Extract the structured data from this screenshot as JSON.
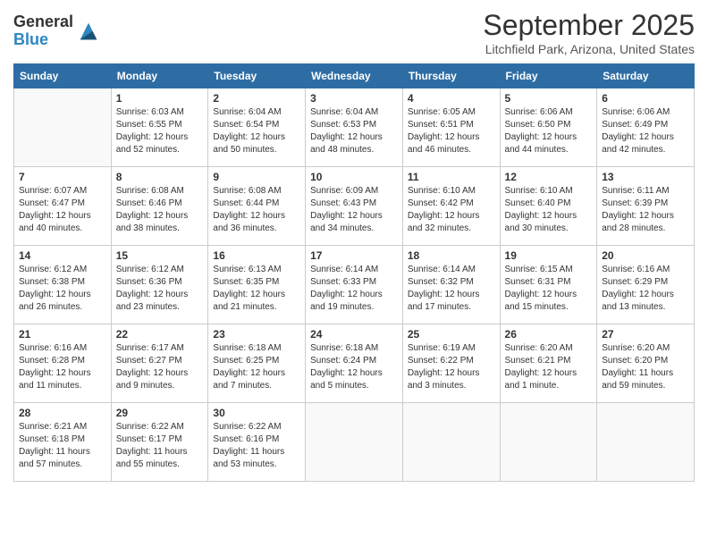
{
  "logo": {
    "general": "General",
    "blue": "Blue"
  },
  "title": "September 2025",
  "location": "Litchfield Park, Arizona, United States",
  "days_of_week": [
    "Sunday",
    "Monday",
    "Tuesday",
    "Wednesday",
    "Thursday",
    "Friday",
    "Saturday"
  ],
  "weeks": [
    [
      {
        "day": "",
        "sunrise": "",
        "sunset": "",
        "daylight": ""
      },
      {
        "day": "1",
        "sunrise": "Sunrise: 6:03 AM",
        "sunset": "Sunset: 6:55 PM",
        "daylight": "Daylight: 12 hours and 52 minutes."
      },
      {
        "day": "2",
        "sunrise": "Sunrise: 6:04 AM",
        "sunset": "Sunset: 6:54 PM",
        "daylight": "Daylight: 12 hours and 50 minutes."
      },
      {
        "day": "3",
        "sunrise": "Sunrise: 6:04 AM",
        "sunset": "Sunset: 6:53 PM",
        "daylight": "Daylight: 12 hours and 48 minutes."
      },
      {
        "day": "4",
        "sunrise": "Sunrise: 6:05 AM",
        "sunset": "Sunset: 6:51 PM",
        "daylight": "Daylight: 12 hours and 46 minutes."
      },
      {
        "day": "5",
        "sunrise": "Sunrise: 6:06 AM",
        "sunset": "Sunset: 6:50 PM",
        "daylight": "Daylight: 12 hours and 44 minutes."
      },
      {
        "day": "6",
        "sunrise": "Sunrise: 6:06 AM",
        "sunset": "Sunset: 6:49 PM",
        "daylight": "Daylight: 12 hours and 42 minutes."
      }
    ],
    [
      {
        "day": "7",
        "sunrise": "Sunrise: 6:07 AM",
        "sunset": "Sunset: 6:47 PM",
        "daylight": "Daylight: 12 hours and 40 minutes."
      },
      {
        "day": "8",
        "sunrise": "Sunrise: 6:08 AM",
        "sunset": "Sunset: 6:46 PM",
        "daylight": "Daylight: 12 hours and 38 minutes."
      },
      {
        "day": "9",
        "sunrise": "Sunrise: 6:08 AM",
        "sunset": "Sunset: 6:44 PM",
        "daylight": "Daylight: 12 hours and 36 minutes."
      },
      {
        "day": "10",
        "sunrise": "Sunrise: 6:09 AM",
        "sunset": "Sunset: 6:43 PM",
        "daylight": "Daylight: 12 hours and 34 minutes."
      },
      {
        "day": "11",
        "sunrise": "Sunrise: 6:10 AM",
        "sunset": "Sunset: 6:42 PM",
        "daylight": "Daylight: 12 hours and 32 minutes."
      },
      {
        "day": "12",
        "sunrise": "Sunrise: 6:10 AM",
        "sunset": "Sunset: 6:40 PM",
        "daylight": "Daylight: 12 hours and 30 minutes."
      },
      {
        "day": "13",
        "sunrise": "Sunrise: 6:11 AM",
        "sunset": "Sunset: 6:39 PM",
        "daylight": "Daylight: 12 hours and 28 minutes."
      }
    ],
    [
      {
        "day": "14",
        "sunrise": "Sunrise: 6:12 AM",
        "sunset": "Sunset: 6:38 PM",
        "daylight": "Daylight: 12 hours and 26 minutes."
      },
      {
        "day": "15",
        "sunrise": "Sunrise: 6:12 AM",
        "sunset": "Sunset: 6:36 PM",
        "daylight": "Daylight: 12 hours and 23 minutes."
      },
      {
        "day": "16",
        "sunrise": "Sunrise: 6:13 AM",
        "sunset": "Sunset: 6:35 PM",
        "daylight": "Daylight: 12 hours and 21 minutes."
      },
      {
        "day": "17",
        "sunrise": "Sunrise: 6:14 AM",
        "sunset": "Sunset: 6:33 PM",
        "daylight": "Daylight: 12 hours and 19 minutes."
      },
      {
        "day": "18",
        "sunrise": "Sunrise: 6:14 AM",
        "sunset": "Sunset: 6:32 PM",
        "daylight": "Daylight: 12 hours and 17 minutes."
      },
      {
        "day": "19",
        "sunrise": "Sunrise: 6:15 AM",
        "sunset": "Sunset: 6:31 PM",
        "daylight": "Daylight: 12 hours and 15 minutes."
      },
      {
        "day": "20",
        "sunrise": "Sunrise: 6:16 AM",
        "sunset": "Sunset: 6:29 PM",
        "daylight": "Daylight: 12 hours and 13 minutes."
      }
    ],
    [
      {
        "day": "21",
        "sunrise": "Sunrise: 6:16 AM",
        "sunset": "Sunset: 6:28 PM",
        "daylight": "Daylight: 12 hours and 11 minutes."
      },
      {
        "day": "22",
        "sunrise": "Sunrise: 6:17 AM",
        "sunset": "Sunset: 6:27 PM",
        "daylight": "Daylight: 12 hours and 9 minutes."
      },
      {
        "day": "23",
        "sunrise": "Sunrise: 6:18 AM",
        "sunset": "Sunset: 6:25 PM",
        "daylight": "Daylight: 12 hours and 7 minutes."
      },
      {
        "day": "24",
        "sunrise": "Sunrise: 6:18 AM",
        "sunset": "Sunset: 6:24 PM",
        "daylight": "Daylight: 12 hours and 5 minutes."
      },
      {
        "day": "25",
        "sunrise": "Sunrise: 6:19 AM",
        "sunset": "Sunset: 6:22 PM",
        "daylight": "Daylight: 12 hours and 3 minutes."
      },
      {
        "day": "26",
        "sunrise": "Sunrise: 6:20 AM",
        "sunset": "Sunset: 6:21 PM",
        "daylight": "Daylight: 12 hours and 1 minute."
      },
      {
        "day": "27",
        "sunrise": "Sunrise: 6:20 AM",
        "sunset": "Sunset: 6:20 PM",
        "daylight": "Daylight: 11 hours and 59 minutes."
      }
    ],
    [
      {
        "day": "28",
        "sunrise": "Sunrise: 6:21 AM",
        "sunset": "Sunset: 6:18 PM",
        "daylight": "Daylight: 11 hours and 57 minutes."
      },
      {
        "day": "29",
        "sunrise": "Sunrise: 6:22 AM",
        "sunset": "Sunset: 6:17 PM",
        "daylight": "Daylight: 11 hours and 55 minutes."
      },
      {
        "day": "30",
        "sunrise": "Sunrise: 6:22 AM",
        "sunset": "Sunset: 6:16 PM",
        "daylight": "Daylight: 11 hours and 53 minutes."
      },
      {
        "day": "",
        "sunrise": "",
        "sunset": "",
        "daylight": ""
      },
      {
        "day": "",
        "sunrise": "",
        "sunset": "",
        "daylight": ""
      },
      {
        "day": "",
        "sunrise": "",
        "sunset": "",
        "daylight": ""
      },
      {
        "day": "",
        "sunrise": "",
        "sunset": "",
        "daylight": ""
      }
    ]
  ]
}
